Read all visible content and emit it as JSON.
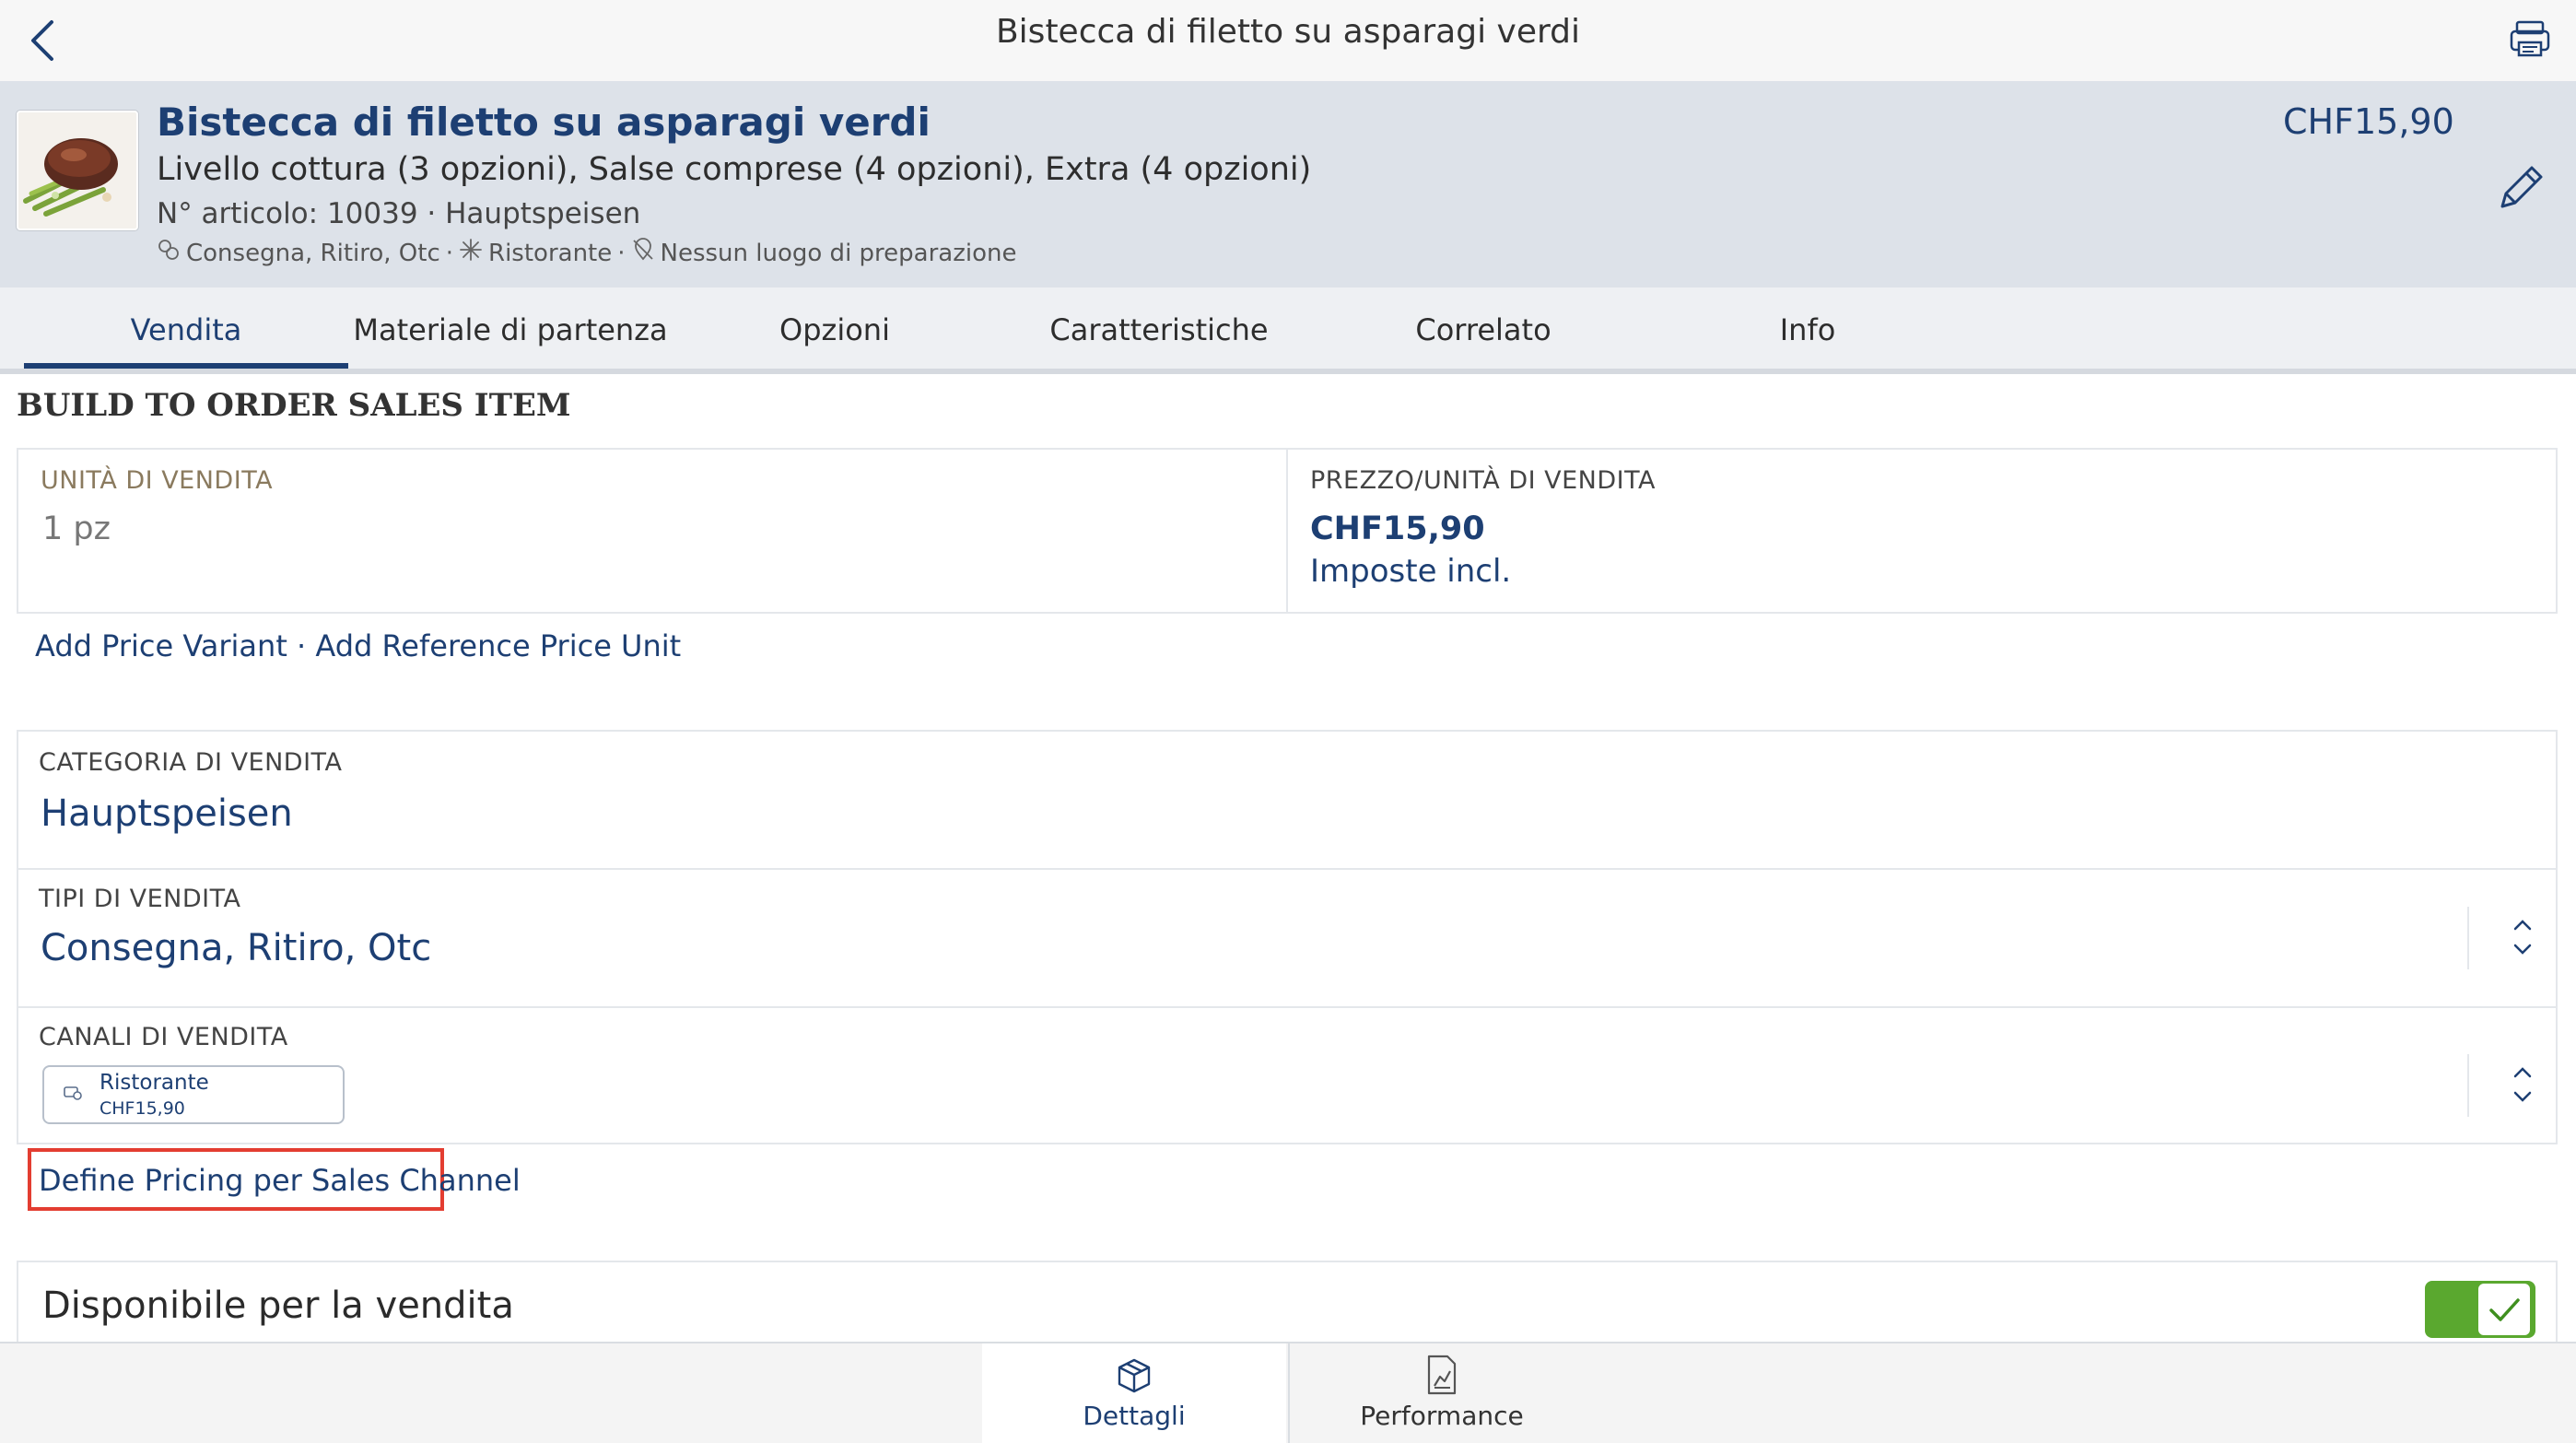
{
  "navbar": {
    "title": "Bistecca di filetto su asparagi verdi",
    "back_icon": "chevron-left-icon",
    "print_icon": "printer-icon"
  },
  "header": {
    "title": "Bistecca di filetto su asparagi verdi",
    "options": "Livello cottura (3 opzioni), Salse comprese (4 opzioni), Extra (4 opzioni)",
    "article": "N° articolo: 10039 · Hauptspeisen",
    "meta": {
      "types": "Consegna, Ritiro, Otc",
      "separator": "·",
      "channel": "Ristorante",
      "preparation": "Nessun luogo di preparazione"
    },
    "price": "CHF15,90",
    "edit_icon": "pencil-icon"
  },
  "tabs": [
    {
      "label": "Vendita",
      "active": true
    },
    {
      "label": "Materiale di partenza"
    },
    {
      "label": "Opzioni"
    },
    {
      "label": "Caratteristiche"
    },
    {
      "label": "Correlato"
    },
    {
      "label": "Info"
    }
  ],
  "section": {
    "title": "BUILD TO ORDER SALES ITEM"
  },
  "unit": {
    "label": "UNITÀ DI VENDITA",
    "value": "1 pz"
  },
  "price": {
    "label": "PREZZO/UNITÀ DI VENDITA",
    "value": "CHF15,90",
    "tax_note": "Imposte incl."
  },
  "links": {
    "add_variant": "Add Price Variant",
    "separator": "·",
    "add_reference": "Add Reference Price Unit",
    "define_pricing": "Define Pricing per Sales Channel"
  },
  "category": {
    "label": "CATEGORIA DI VENDITA",
    "value": "Hauptspeisen"
  },
  "sales_types": {
    "label": "TIPI DI VENDITA",
    "value": "Consegna, Ritiro, Otc"
  },
  "channels": {
    "label": "CANALI DI VENDITA",
    "chip": {
      "name": "Ristorante",
      "price": "CHF15,90"
    }
  },
  "availability": {
    "label": "Disponibile per la vendita",
    "enabled": true,
    "color": "#5aa82f"
  },
  "bottom_tabs": [
    {
      "label": "Dettagli",
      "icon": "box-icon",
      "active": true
    },
    {
      "label": "Performance",
      "icon": "chart-document-icon"
    }
  ],
  "colors": {
    "accent": "#1d3f73",
    "header_bg": "#dde2e9",
    "highlight": "#e33d31"
  }
}
